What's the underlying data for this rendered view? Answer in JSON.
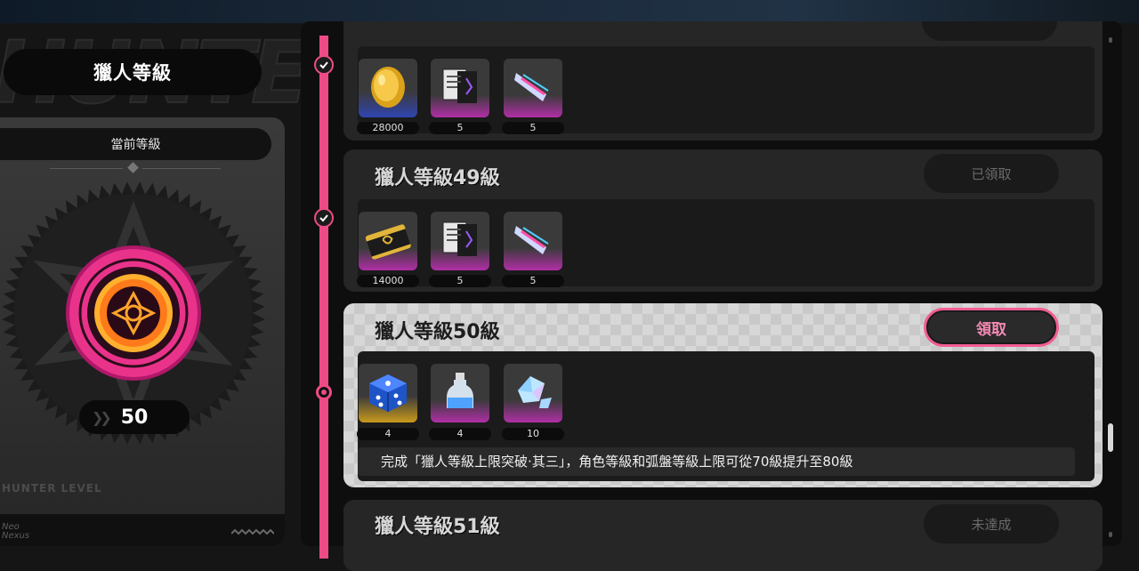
{
  "left": {
    "title": "獵人等級",
    "current_label": "當前等級",
    "level_value": "50",
    "footer_text": "HUNTER LEVEL",
    "badge_ring_text": "effect"
  },
  "rewards": [
    {
      "level_label": "",
      "status": "claimed",
      "items": [
        {
          "icon": "gold-coin-icon",
          "rarity": "blue",
          "qty": "28000"
        },
        {
          "icon": "document-card-icon",
          "rarity": "purple",
          "qty": "5"
        },
        {
          "icon": "crystal-shard-icon",
          "rarity": "purple",
          "qty": "5"
        }
      ]
    },
    {
      "level_label": "獵人等級49級",
      "button_label": "已領取",
      "status": "claimed",
      "items": [
        {
          "icon": "ticket-card-icon",
          "rarity": "purple",
          "qty": "14000"
        },
        {
          "icon": "document-card-icon",
          "rarity": "purple",
          "qty": "5"
        },
        {
          "icon": "crystal-shard-icon",
          "rarity": "purple",
          "qty": "5"
        }
      ]
    },
    {
      "level_label": "獵人等級50級",
      "button_label": "領取",
      "status": "claimable",
      "items": [
        {
          "icon": "blue-dice-icon",
          "rarity": "gold",
          "qty": "4"
        },
        {
          "icon": "potion-bottle-icon",
          "rarity": "purple",
          "qty": "4"
        },
        {
          "icon": "ice-crystal-icon",
          "rarity": "purple",
          "qty": "10"
        }
      ],
      "description": "完成「獵人等級上限突破·其三」，角色等級和弧盤等級上限可從70級提升至80級"
    },
    {
      "level_label": "獵人等級51級",
      "button_label": "未達成",
      "status": "locked"
    }
  ],
  "colors": {
    "accent": "#ee4b86",
    "panel": "#262626",
    "background": "#151515"
  }
}
